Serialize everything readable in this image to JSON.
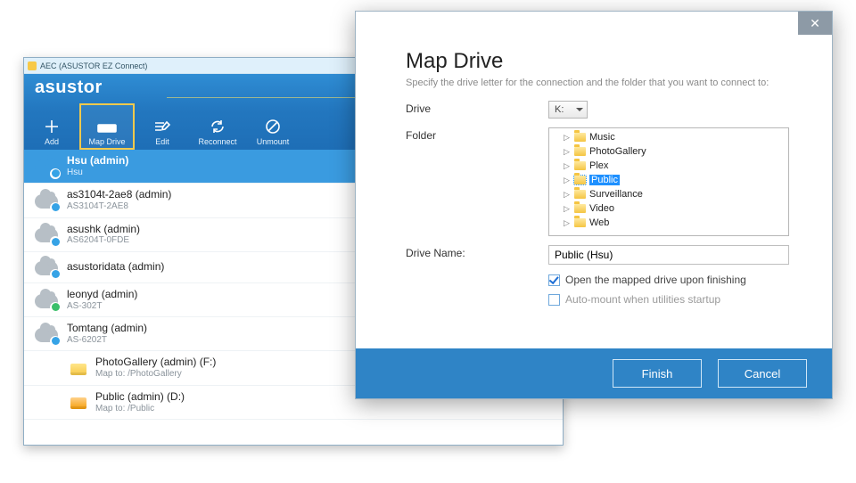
{
  "aec": {
    "title": "AEC (ASUSTOR EZ Connect)",
    "logo": "asustor",
    "toolbar": [
      {
        "id": "add",
        "label": "Add"
      },
      {
        "id": "mapdrive",
        "label": "Map Drive"
      },
      {
        "id": "edit",
        "label": "Edit"
      },
      {
        "id": "reconnect",
        "label": "Reconnect"
      },
      {
        "id": "unmount",
        "label": "Unmount"
      }
    ],
    "active_toolbar": "mapdrive",
    "connections": [
      {
        "name": "Hsu (admin)",
        "sub": "Hsu",
        "type": "user",
        "badge": "check",
        "selected": true
      },
      {
        "name": "as3104t-2ae8 (admin)",
        "sub": "AS3104T-2AE8",
        "type": "nas",
        "badge": "check"
      },
      {
        "name": "asushk (admin)",
        "sub": "AS6204T-0FDE",
        "type": "nas",
        "badge": "check"
      },
      {
        "name": "asustoridata (admin)",
        "sub": "",
        "type": "nas",
        "badge": "check"
      },
      {
        "name": "leonyd (admin)",
        "sub": "AS-302T",
        "type": "nas",
        "badge": "ok"
      },
      {
        "name": "Tomtang (admin)",
        "sub": "AS-6202T",
        "type": "nas",
        "badge": "check"
      }
    ],
    "mapped": [
      {
        "name": "PhotoGallery (admin) (F:)",
        "sub": "Map to: /PhotoGallery",
        "color": "yellow"
      },
      {
        "name": "Public (admin) (D:)",
        "sub": "Map to: /Public",
        "color": "orange"
      }
    ]
  },
  "modal": {
    "title": "Map Drive",
    "desc": "Specify the drive letter for the connection and the folder that you want to connect to:",
    "drive_label": "Drive",
    "drive_value": "K:",
    "folder_label": "Folder",
    "folders": [
      {
        "name": "Music"
      },
      {
        "name": "PhotoGallery"
      },
      {
        "name": "Plex"
      },
      {
        "name": "Public",
        "selected": true
      },
      {
        "name": "Surveillance"
      },
      {
        "name": "Video"
      },
      {
        "name": "Web"
      }
    ],
    "drive_name_label": "Drive Name:",
    "drive_name_value": "Public (Hsu)",
    "open_label": "Open the mapped drive upon finishing",
    "open_checked": true,
    "auto_label": "Auto-mount when utilities startup",
    "auto_checked": false,
    "finish": "Finish",
    "cancel": "Cancel",
    "close_x": "✕"
  }
}
